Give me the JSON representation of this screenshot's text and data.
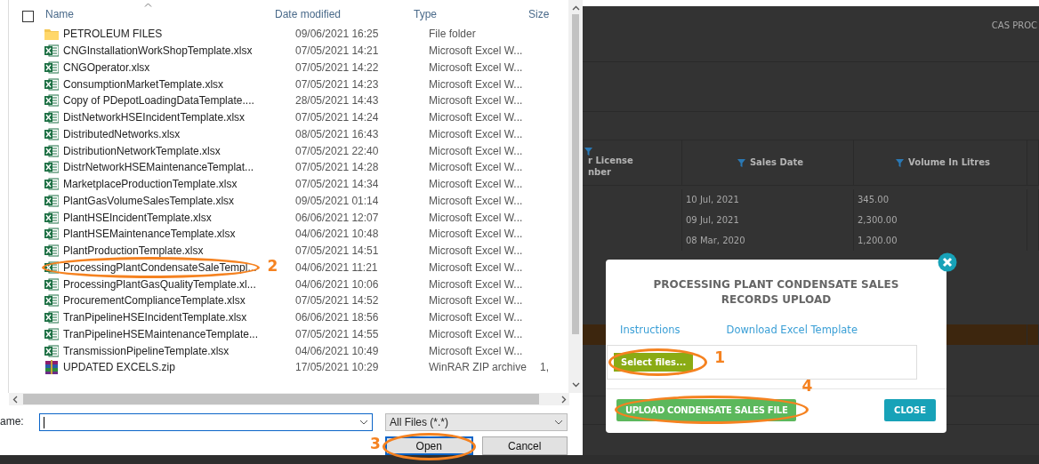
{
  "file_dialog": {
    "select_all_checked": false,
    "columns": [
      "Name",
      "Date modified",
      "Type",
      "Size"
    ],
    "files": [
      {
        "kind": "folder",
        "name": "PETROLEUM FILES",
        "date": "09/06/2021 16:25",
        "type": "File folder"
      },
      {
        "kind": "excel",
        "name": "CNGInstallationWorkShopTemplate.xlsx",
        "date": "07/05/2021 14:21",
        "type": "Microsoft Excel W..."
      },
      {
        "kind": "excel",
        "name": "CNGOperator.xlsx",
        "date": "07/05/2021 14:22",
        "type": "Microsoft Excel W..."
      },
      {
        "kind": "excel",
        "name": "ConsumptionMarketTemplate.xlsx",
        "date": "07/05/2021 14:23",
        "type": "Microsoft Excel W..."
      },
      {
        "kind": "excel",
        "name": "Copy of PDepotLoadingDataTemplate....",
        "date": "28/05/2021 14:43",
        "type": "Microsoft Excel W..."
      },
      {
        "kind": "excel",
        "name": "DistNetworkHSEIncidentTemplate.xlsx",
        "date": "07/05/2021 14:24",
        "type": "Microsoft Excel W..."
      },
      {
        "kind": "excel",
        "name": "DistributedNetworks.xlsx",
        "date": "08/05/2021 16:43",
        "type": "Microsoft Excel W..."
      },
      {
        "kind": "excel",
        "name": "DistributionNetworkTemplate.xlsx",
        "date": "07/05/2021 22:40",
        "type": "Microsoft Excel W..."
      },
      {
        "kind": "excel",
        "name": "DistrNetworkHSEMaintenanceTemplat...",
        "date": "07/05/2021 14:28",
        "type": "Microsoft Excel W..."
      },
      {
        "kind": "excel",
        "name": "MarketplaceProductionTemplate.xlsx",
        "date": "07/05/2021 14:34",
        "type": "Microsoft Excel W..."
      },
      {
        "kind": "excel",
        "name": "PlantGasVolumeSalesTemplate.xlsx",
        "date": "09/05/2021 01:14",
        "type": "Microsoft Excel W..."
      },
      {
        "kind": "excel",
        "name": "PlantHSEIncidentTemplate.xlsx",
        "date": "06/06/2021 12:07",
        "type": "Microsoft Excel W..."
      },
      {
        "kind": "excel",
        "name": "PlantHSEMaintenanceTemplate.xlsx",
        "date": "04/06/2021 10:48",
        "type": "Microsoft Excel W..."
      },
      {
        "kind": "excel",
        "name": "PlantProductionTemplate.xlsx",
        "date": "07/05/2021 14:51",
        "type": "Microsoft Excel W..."
      },
      {
        "kind": "excel",
        "name": "ProcessingPlantCondensateSaleTempl...",
        "date": "04/06/2021 11:21",
        "type": "Microsoft Excel W...",
        "annotation": "2"
      },
      {
        "kind": "excel",
        "name": "ProcessingPlantGasQualityTemplate.xl...",
        "date": "04/06/2021 10:06",
        "type": "Microsoft Excel W..."
      },
      {
        "kind": "excel",
        "name": "ProcurementComplianceTemplate.xlsx",
        "date": "07/05/2021 14:52",
        "type": "Microsoft Excel W..."
      },
      {
        "kind": "excel",
        "name": "TranPipelineHSEIncidentTemplate.xlsx",
        "date": "06/06/2021 18:56",
        "type": "Microsoft Excel W..."
      },
      {
        "kind": "excel",
        "name": "TranPipelineHSEMaintenanceTemplate...",
        "date": "07/05/2021 14:55",
        "type": "Microsoft Excel W..."
      },
      {
        "kind": "excel",
        "name": "TransmissionPipelineTemplate.xlsx",
        "date": "04/06/2021 10:49",
        "type": "Microsoft Excel W..."
      },
      {
        "kind": "archive",
        "name": "UPDATED EXCELS.zip",
        "date": "17/05/2021 10:29",
        "type": "WinRAR ZIP archive",
        "size": "1,"
      }
    ],
    "filename_label": "ame:",
    "file_type": "All Files (*.*)",
    "open_button": {
      "label": "Open",
      "annotation": "3"
    },
    "cancel_button": "Cancel"
  },
  "page": {
    "header_title": "CAS PROC",
    "table": {
      "columns": [
        {
          "lines": [
            "r License",
            "nber"
          ]
        },
        {
          "lines": [
            "Sales Date"
          ]
        },
        {
          "lines": [
            "Volume In Litres"
          ]
        }
      ],
      "rows": [
        {
          "sales_date": "10 Jul, 2021",
          "volume": "345.00",
          "selected": false
        },
        {
          "sales_date": "09 Jul, 2021",
          "volume": "2,300.00",
          "selected": false
        },
        {
          "sales_date": "08 Mar, 2020",
          "volume": "1,200.00",
          "selected": false
        },
        {
          "selected": true
        }
      ]
    }
  },
  "modal": {
    "title": "PROCESSING PLANT CONDENSATE SALES RECORDS UPLOAD",
    "links": [
      "Instructions",
      "Download Excel Template"
    ],
    "select_button": {
      "label": "Select files...",
      "annotation": "1"
    },
    "upload_button": {
      "label": "UPLOAD CONDENSATE SALES FILE",
      "annotation": "4"
    },
    "close_button": "CLOSE"
  }
}
